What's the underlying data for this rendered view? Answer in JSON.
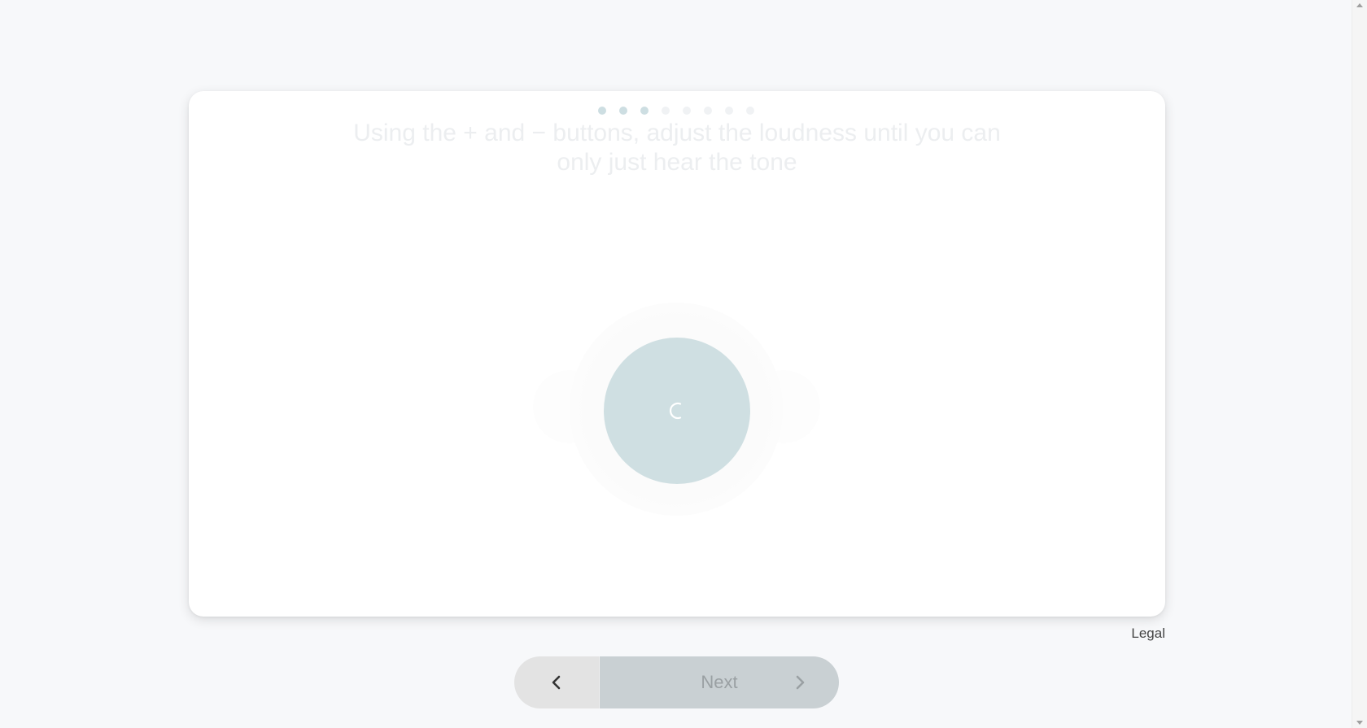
{
  "progress": {
    "total_steps": 8,
    "completed_steps": 3
  },
  "instruction": {
    "text": "Using the + and − buttons, adjust the loudness until you can only just hear the tone"
  },
  "tone_button": {
    "icon": "loading-spinner-icon"
  },
  "footer": {
    "legal_label": "Legal"
  },
  "navigation": {
    "back_icon": "chevron-left-icon",
    "next_label": "Next",
    "next_icon": "chevron-right-icon"
  },
  "colors": {
    "active_dot": "#cddee2",
    "inactive_dot": "#f0f2f4",
    "tone_button": "#cfdfe2",
    "next_button": "#c9d0d3",
    "back_button": "#e3e3e3"
  }
}
